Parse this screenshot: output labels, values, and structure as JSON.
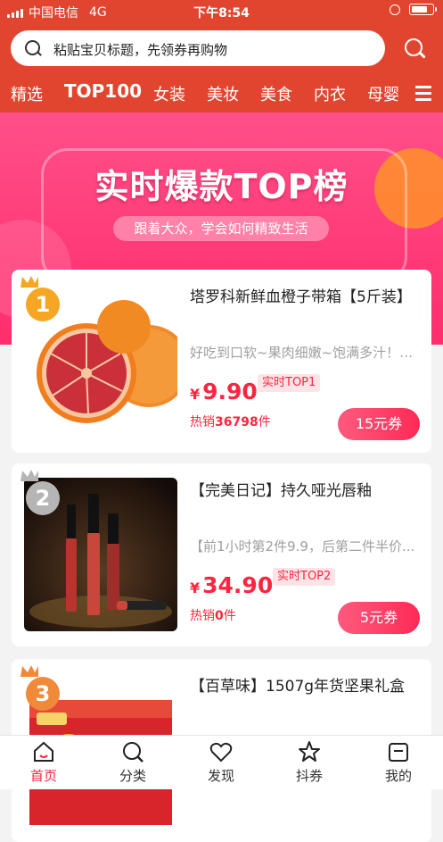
{
  "status_bar": {
    "carrier": "中国电信",
    "network": "4G",
    "time": "下午8:54"
  },
  "search": {
    "placeholder": "粘贴宝贝标题，先领券再购物"
  },
  "nav_tabs": [
    "精选",
    "TOP100",
    "女装",
    "美妆",
    "美食",
    "内衣",
    "母婴"
  ],
  "active_nav": "TOP100",
  "banner": {
    "title": "实时爆款TOP榜",
    "subtitle": "跟着大众，学会如何精致生活"
  },
  "products": [
    {
      "rank": "1",
      "title": "塔罗科新鲜血橙子带箱【5斤装】",
      "desc": "好吃到口软~果肉细嫩~饱满多汁！被...",
      "currency": "¥",
      "price": "9.90",
      "badge": "实时TOP1",
      "sold_prefix": "热销",
      "sold_count": "36798",
      "sold_suffix": "件",
      "coupon": "15元券"
    },
    {
      "rank": "2",
      "title": "【完美日记】持久哑光唇釉",
      "desc": "【前1小时第2件9.9，后第二件半价...",
      "currency": "¥",
      "price": "34.90",
      "badge": "实时TOP2",
      "sold_prefix": "热销",
      "sold_count": "0",
      "sold_suffix": "件",
      "coupon": "5元券"
    },
    {
      "rank": "3",
      "title": "【百草味】1507g年货坚果礼盒",
      "desc": "",
      "currency": "",
      "price": "",
      "badge": "",
      "sold_prefix": "",
      "sold_count": "",
      "sold_suffix": "",
      "coupon": ""
    }
  ],
  "product_images": [
    "orange-image",
    "lip-gloss-image",
    "nut-gift-box-image"
  ],
  "bottom_tabs": [
    {
      "label": "首页",
      "icon": "home-icon"
    },
    {
      "label": "分类",
      "icon": "search-icon"
    },
    {
      "label": "发现",
      "icon": "heart-icon"
    },
    {
      "label": "抖券",
      "icon": "star-icon"
    },
    {
      "label": "我的",
      "icon": "profile-icon"
    }
  ],
  "active_tab": "首页",
  "colors": {
    "header": "#e2452f",
    "banner": "#ff2d6c",
    "accent": "#ff2540",
    "medal_gold": "#f5a623",
    "medal_silver": "#b5b5b5",
    "medal_bronze": "#f08a3a"
  }
}
